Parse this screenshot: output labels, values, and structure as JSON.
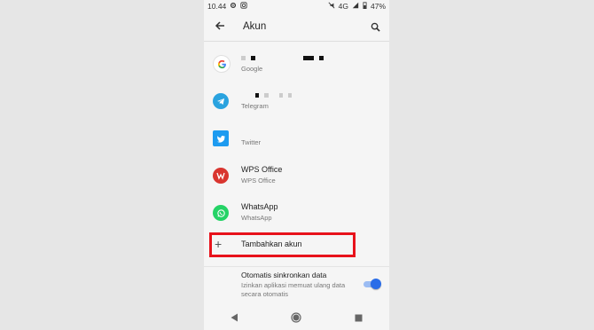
{
  "status": {
    "time": "10.44",
    "network": "4G",
    "battery": "47%"
  },
  "appbar": {
    "title": "Akun"
  },
  "accounts": [
    {
      "label": "Google",
      "icon": "google-icon"
    },
    {
      "label": "Telegram",
      "icon": "telegram-icon"
    },
    {
      "label": "Twitter",
      "icon": "twitter-icon"
    },
    {
      "name": "WPS Office",
      "label": "WPS Office",
      "icon": "wps-office-icon"
    },
    {
      "name": "WhatsApp",
      "label": "WhatsApp",
      "icon": "whatsapp-icon"
    }
  ],
  "add_account": {
    "label": "Tambahkan akun"
  },
  "sync": {
    "title": "Otomatis sinkronkan data",
    "desc": "Izinkan aplikasi memuat ulang data secara otomatis",
    "enabled": true
  },
  "colors": {
    "accent": "#2a6de8",
    "highlight": "#e8121b"
  }
}
